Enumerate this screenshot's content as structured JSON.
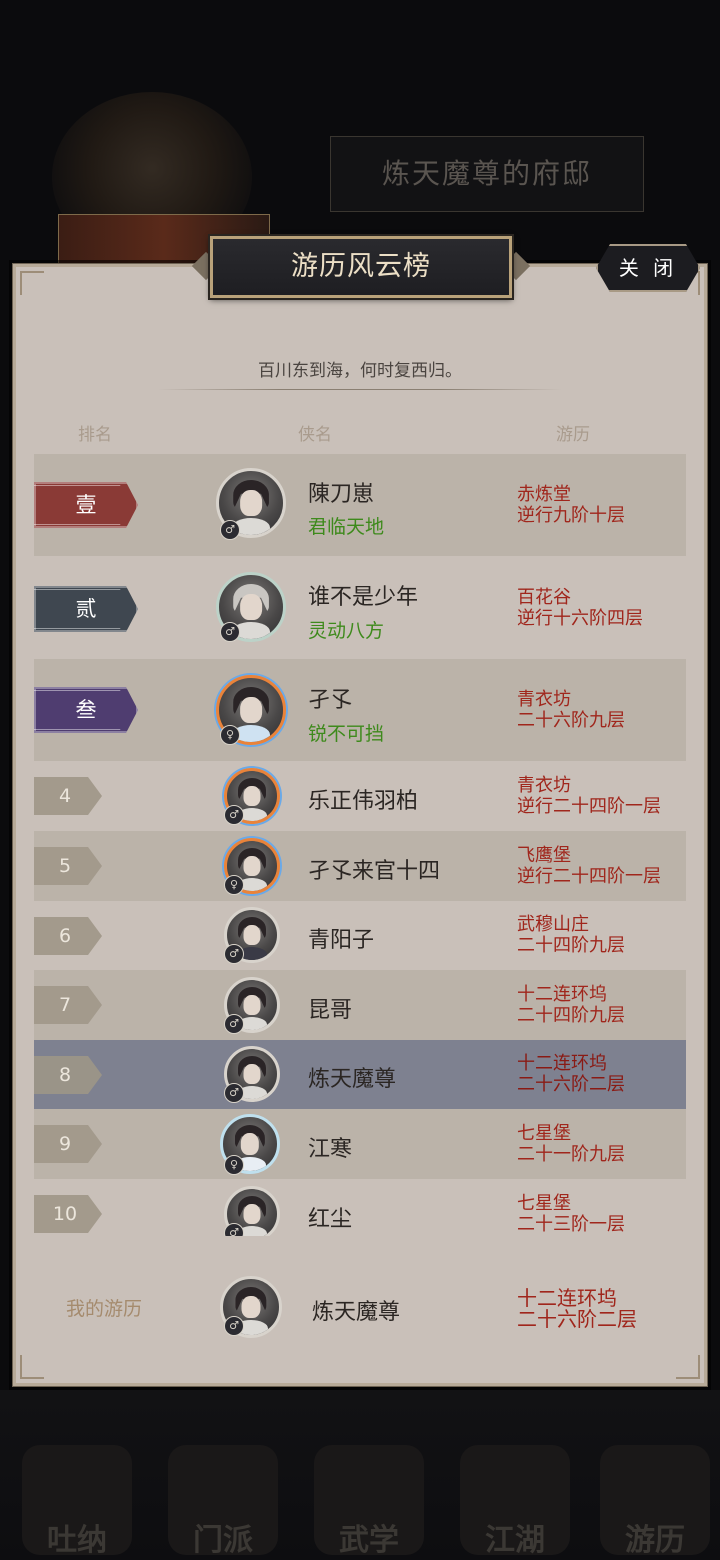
{
  "background": {
    "mansion_title": "炼天魔尊的府邸",
    "nav_items": [
      "吐纳",
      "门派",
      "武学",
      "江湖",
      "游历"
    ]
  },
  "dialog": {
    "title": "游历风云榜",
    "close_label": "关 闭",
    "motto": "百川东到海，何时复西归。",
    "columns": {
      "rank": "排名",
      "name": "侠名",
      "journey": "游历"
    }
  },
  "rankings": [
    {
      "rank": "壹",
      "name": "陳刀崽",
      "title": "君临天地",
      "journey_line1": "赤炼堂",
      "journey_line2": "逆行九阶十层",
      "gender": "♂"
    },
    {
      "rank": "贰",
      "name": "谁不是少年",
      "title": "灵动八方",
      "journey_line1": "百花谷",
      "journey_line2": "逆行十六阶四层",
      "gender": "♂"
    },
    {
      "rank": "叁",
      "name": "孑孓",
      "title": "锐不可挡",
      "journey_line1": "青衣坊",
      "journey_line2": "二十六阶九层",
      "gender": "♀"
    },
    {
      "rank": "4",
      "name": "乐正伟羽柏",
      "journey_line1": "青衣坊",
      "journey_line2": "逆行二十四阶一层",
      "gender": "♂"
    },
    {
      "rank": "5",
      "name": "孑孓来官十四",
      "journey_line1": "飞鹰堡",
      "journey_line2": "逆行二十四阶一层",
      "gender": "♀"
    },
    {
      "rank": "6",
      "name": "青阳子",
      "journey_line1": "武穆山庄",
      "journey_line2": "二十四阶九层",
      "gender": "♂"
    },
    {
      "rank": "7",
      "name": "昆哥",
      "journey_line1": "十二连环坞",
      "journey_line2": "二十四阶九层",
      "gender": "♂"
    },
    {
      "rank": "8",
      "name": "炼天魔尊",
      "journey_line1": "十二连环坞",
      "journey_line2": "二十六阶二层",
      "gender": "♂"
    },
    {
      "rank": "9",
      "name": "江寒",
      "journey_line1": "七星堡",
      "journey_line2": "二十一阶九层",
      "gender": "♀"
    },
    {
      "rank": "10",
      "name": "红尘",
      "journey_line1": "七星堡",
      "journey_line2": "二十三阶一层",
      "gender": "♂"
    }
  ],
  "my_record": {
    "label": "我的游历",
    "name": "炼天魔尊",
    "journey_line1": "十二连环坞",
    "journey_line2": "二十六阶二层",
    "gender": "♂"
  },
  "colors": {
    "rank1_banner": "#8a3a36",
    "rank2_banner": "#3f4750",
    "rank3_banner": "#4f3d70",
    "highlight_row": "#7e8190",
    "title_text": "#3e8a1c",
    "journey_text": "#a0261c"
  }
}
